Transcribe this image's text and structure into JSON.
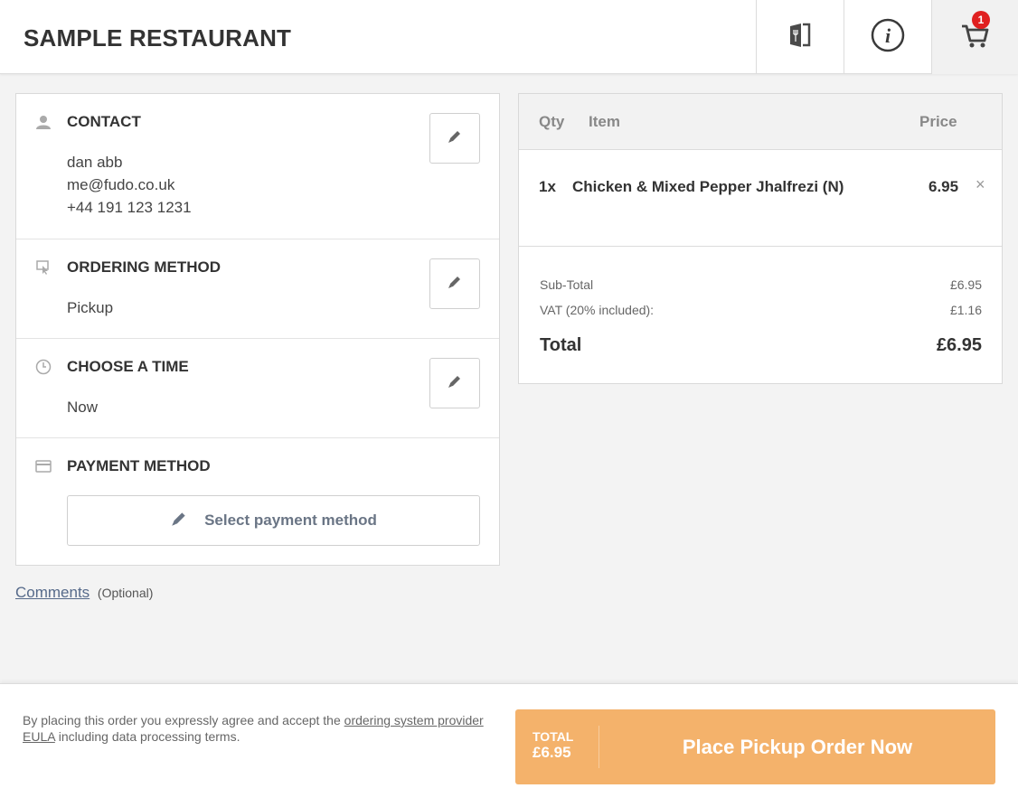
{
  "header": {
    "title": "SAMPLE RESTAURANT",
    "menu_icon": "menu-book-icon",
    "info_icon": "info-icon",
    "cart_icon": "cart-icon",
    "cart_count": "1"
  },
  "checkout": {
    "contact": {
      "title": "CONTACT",
      "name": "dan abb",
      "email": "me@fudo.co.uk",
      "phone": "+44 191 123 1231"
    },
    "ordering_method": {
      "title": "ORDERING METHOD",
      "value": "Pickup"
    },
    "time": {
      "title": "CHOOSE A TIME",
      "value": "Now"
    },
    "payment": {
      "title": "PAYMENT METHOD",
      "button_label": "Select payment method"
    },
    "comments_link": "Comments",
    "comments_optional": "(Optional)"
  },
  "cart": {
    "columns": {
      "qty": "Qty",
      "item": "Item",
      "price": "Price"
    },
    "items": [
      {
        "qty": "1x",
        "name": "Chicken & Mixed Pepper Jhalfrezi (N)",
        "price": "6.95",
        "remove": "×"
      }
    ],
    "subtotal_label": "Sub-Total",
    "subtotal_value": "£6.95",
    "vat_label": "VAT (20% included):",
    "vat_value": "£1.16",
    "total_label": "Total",
    "total_value": "£6.95"
  },
  "footer": {
    "legal_prefix": "By placing this order you expressly agree and accept the ",
    "legal_link": "ordering system provider EULA",
    "legal_suffix": " including data processing terms.",
    "button_total_label": "TOTAL",
    "button_total_value": "£6.95",
    "button_label": "Place Pickup Order Now",
    "button_color": "#f4b26b"
  }
}
